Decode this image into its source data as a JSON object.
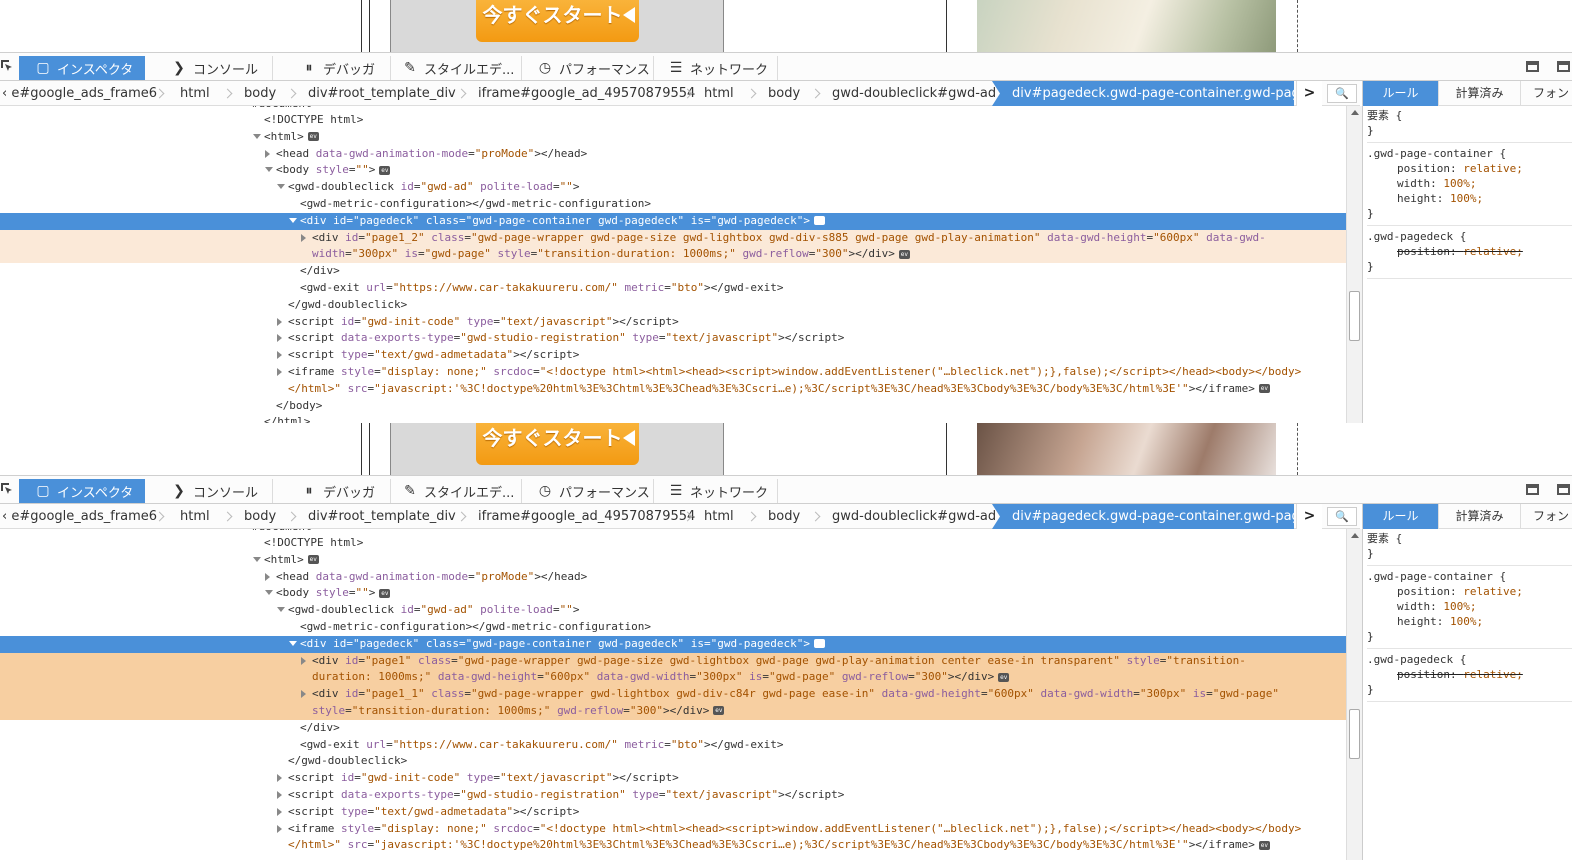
{
  "preview": {
    "ad_button_label": "今すぐスタート"
  },
  "toolbar": {
    "tabs": [
      {
        "label": "インスペクタ",
        "icon": "inspector-icon"
      },
      {
        "label": "コンソール",
        "icon": "console-icon"
      },
      {
        "label": "デバッガ",
        "icon": "debugger-icon"
      },
      {
        "label": "スタイルエデ...",
        "icon": "style-editor-icon"
      },
      {
        "label": "パフォーマンス",
        "icon": "performance-icon"
      },
      {
        "label": "ネットワーク",
        "icon": "network-icon"
      }
    ]
  },
  "breadcrumb": {
    "items": [
      "e#google_ads_frame6",
      "html",
      "body",
      "div#root_template_div",
      "iframe#google_ad_49570879554",
      "html",
      "body",
      "gwd-doubleclick#gwd-ad",
      "div#pagedeck.gwd-page-container.gwd-page..."
    ],
    "overflow_arrow": ">"
  },
  "rules_tabs": [
    "ルール",
    "計算済み",
    "フォン"
  ],
  "rules": [
    {
      "selector": "要素 {",
      "decls": [],
      "close": "}"
    },
    {
      "selector": ".gwd-page-container {",
      "decls": [
        {
          "prop": "position",
          "value": "relative;"
        },
        {
          "prop": "width",
          "value": "100%;"
        },
        {
          "prop": "height",
          "value": "100%;"
        }
      ],
      "close": "}"
    },
    {
      "selector": ".gwd-pagedeck {",
      "decls": [
        {
          "prop": "position",
          "value": "relative;",
          "strike": true
        }
      ],
      "close": "}"
    }
  ],
  "markup_top": [
    {
      "indent": 0,
      "tw": "none",
      "html": "<span class='c-tag'>#document</span>",
      "partial": true
    },
    {
      "indent": 1,
      "tw": "none",
      "html": "<span class='c-tag'>&lt;!DOCTYPE html&gt;</span>"
    },
    {
      "indent": 1,
      "tw": "open",
      "html": "<span class='c-tag'>&lt;html&gt;</span><span class='ev'>ev</span>"
    },
    {
      "indent": 2,
      "tw": "closed",
      "html": "<span class='c-tag'>&lt;head </span><span class='c-attr'>data-gwd-animation-mode</span>=<span class='c-val'>\"proMode\"</span><span class='c-tag'>&gt;&lt;/head&gt;</span>"
    },
    {
      "indent": 2,
      "tw": "open",
      "html": "<span class='c-tag'>&lt;body </span><span class='c-attr'>style</span>=<span class='c-val'>\"\"</span><span class='c-tag'>&gt;</span><span class='ev'>ev</span>"
    },
    {
      "indent": 3,
      "tw": "open",
      "html": "<span class='c-tag'>&lt;gwd-doubleclick </span><span class='c-attr'>id</span>=<span class='c-val'>\"gwd-ad\"</span> <span class='c-attr'>polite-load</span>=<span class='c-val'>\"\"</span><span class='c-tag'>&gt;</span>"
    },
    {
      "indent": 4,
      "tw": "none",
      "html": "<span class='c-tag'>&lt;gwd-metric-configuration&gt;&lt;/gwd-metric-configuration&gt;</span>"
    },
    {
      "indent": 4,
      "tw": "open",
      "cls": "sel",
      "html": "<span class='c-tag'>&lt;div </span><span class='c-attr'>id</span>=<span class='c-val'>\"pagedeck\"</span> <span class='c-attr'>class</span>=<span class='c-val'>\"gwd-page-container gwd-pagedeck\"</span> <span class='c-attr'>is</span>=<span class='c-val'>\"gwd-pagedeck\"</span><span class='c-tag'>&gt;</span><span class='ev'>ev</span>"
    },
    {
      "indent": 5,
      "tw": "closed",
      "cls": "hov",
      "html": "<span class='c-tag'>&lt;div </span><span class='c-attr'>id</span>=<span class='c-val'>\"page1_2\"</span> <span class='c-attr'>class</span>=<span class='c-val'>\"gwd-page-wrapper gwd-page-size gwd-lightbox gwd-div-s885 gwd-page gwd-play-animation\"</span> <span class='c-attr'>data-gwd-height</span>=<span class='c-val'>\"600px\"</span> <span class='c-attr'>data-gwd-</span>"
    },
    {
      "indent": 5,
      "tw": "none",
      "cls": "hov",
      "html": "<span class='c-attr'>width</span>=<span class='c-val'>\"300px\"</span> <span class='c-attr'>is</span>=<span class='c-val'>\"gwd-page\"</span> <span class='c-attr'>style</span>=<span class='c-val'>\"transition-duration: 1000ms;\"</span> <span class='c-attr'>gwd-reflow</span>=<span class='c-val'>\"300\"</span><span class='c-tag'>&gt;&lt;/div&gt;</span><span class='ev'>ev</span>"
    },
    {
      "indent": 4,
      "tw": "none",
      "html": "<span class='c-tag'>&lt;/div&gt;</span>"
    },
    {
      "indent": 4,
      "tw": "none",
      "html": "<span class='c-tag'>&lt;gwd-exit </span><span class='c-attr'>url</span>=<span class='c-val'>\"https://www.car-takakuureru.com/\"</span> <span class='c-attr'>metric</span>=<span class='c-val'>\"bto\"</span><span class='c-tag'>&gt;&lt;/gwd-exit&gt;</span>"
    },
    {
      "indent": 3,
      "tw": "none",
      "html": "<span class='c-tag'>&lt;/gwd-doubleclick&gt;</span>"
    },
    {
      "indent": 3,
      "tw": "closed",
      "html": "<span class='c-tag'>&lt;script </span><span class='c-attr'>id</span>=<span class='c-val'>\"gwd-init-code\"</span> <span class='c-attr'>type</span>=<span class='c-val'>\"text/javascript\"</span><span class='c-tag'>&gt;&lt;/script&gt;</span>"
    },
    {
      "indent": 3,
      "tw": "closed",
      "html": "<span class='c-tag'>&lt;script </span><span class='c-attr'>data-exports-type</span>=<span class='c-val'>\"gwd-studio-registration\"</span> <span class='c-attr'>type</span>=<span class='c-val'>\"text/javascript\"</span><span class='c-tag'>&gt;&lt;/script&gt;</span>"
    },
    {
      "indent": 3,
      "tw": "closed",
      "html": "<span class='c-tag'>&lt;script </span><span class='c-attr'>type</span>=<span class='c-val'>\"text/gwd-admetadata\"</span><span class='c-tag'>&gt;&lt;/script&gt;</span>"
    },
    {
      "indent": 3,
      "tw": "closed",
      "html": "<span class='c-tag'>&lt;iframe </span><span class='c-attr'>style</span>=<span class='c-val'>\"display: none;\"</span> <span class='c-attr'>srcdoc</span>=<span class='c-val'>\"&lt;!doctype html&gt;&lt;html&gt;&lt;head&gt;&lt;script&gt;window.addEventListener(\"…bleclick.net\");},false);&lt;/script&gt;&lt;/head&gt;&lt;body&gt;&lt;/body&gt;</span>"
    },
    {
      "indent": 3,
      "tw": "none",
      "html": "<span class='c-val'>&lt;/html&gt;\"</span> <span class='c-attr'>src</span>=<span class='c-val'>\"javascript:'%3C!doctype%20html%3E%3Chtml%3E%3Chead%3E%3Cscri…e);%3C/script%3E%3C/head%3E%3Cbody%3E%3C/body%3E%3C/html%3E'\"</span><span class='c-tag'>&gt;&lt;/iframe&gt;</span><span class='ev'>ev</span>"
    },
    {
      "indent": 2,
      "tw": "none",
      "html": "<span class='c-tag'>&lt;/body&gt;</span>"
    },
    {
      "indent": 1,
      "tw": "none",
      "html": "<span class='c-tag'>&lt;/html&gt;</span>"
    }
  ],
  "markup_bottom": [
    {
      "indent": 0,
      "tw": "none",
      "html": "<span class='c-tag'>#document</span>",
      "partial": true
    },
    {
      "indent": 1,
      "tw": "none",
      "html": "<span class='c-tag'>&lt;!DOCTYPE html&gt;</span>"
    },
    {
      "indent": 1,
      "tw": "open",
      "html": "<span class='c-tag'>&lt;html&gt;</span><span class='ev'>ev</span>"
    },
    {
      "indent": 2,
      "tw": "closed",
      "html": "<span class='c-tag'>&lt;head </span><span class='c-attr'>data-gwd-animation-mode</span>=<span class='c-val'>\"proMode\"</span><span class='c-tag'>&gt;&lt;/head&gt;</span>"
    },
    {
      "indent": 2,
      "tw": "open",
      "html": "<span class='c-tag'>&lt;body </span><span class='c-attr'>style</span>=<span class='c-val'>\"\"</span><span class='c-tag'>&gt;</span><span class='ev'>ev</span>"
    },
    {
      "indent": 3,
      "tw": "open",
      "html": "<span class='c-tag'>&lt;gwd-doubleclick </span><span class='c-attr'>id</span>=<span class='c-val'>\"gwd-ad\"</span> <span class='c-attr'>polite-load</span>=<span class='c-val'>\"\"</span><span class='c-tag'>&gt;</span>"
    },
    {
      "indent": 4,
      "tw": "none",
      "html": "<span class='c-tag'>&lt;gwd-metric-configuration&gt;&lt;/gwd-metric-configuration&gt;</span>"
    },
    {
      "indent": 4,
      "tw": "open",
      "cls": "sel",
      "html": "<span class='c-tag'>&lt;div </span><span class='c-attr'>id</span>=<span class='c-val'>\"pagedeck\"</span> <span class='c-attr'>class</span>=<span class='c-val'>\"gwd-page-container gwd-pagedeck\"</span> <span class='c-attr'>is</span>=<span class='c-val'>\"gwd-pagedeck\"</span><span class='c-tag'>&gt;</span><span class='ev'>ev</span>"
    },
    {
      "indent": 5,
      "tw": "closed",
      "cls": "hov2",
      "html": "<span class='c-tag'>&lt;div </span><span class='c-attr'>id</span>=<span class='c-val'>\"page1\"</span> <span class='c-attr'>class</span>=<span class='c-val'>\"gwd-page-wrapper gwd-page-size gwd-lightbox gwd-page gwd-play-animation center ease-in transparent\"</span> <span class='c-attr'>style</span>=<span class='c-val'>\"transition-</span>"
    },
    {
      "indent": 5,
      "tw": "none",
      "cls": "hov2",
      "html": "<span class='c-val'>duration: 1000ms;\"</span> <span class='c-attr'>data-gwd-height</span>=<span class='c-val'>\"600px\"</span> <span class='c-attr'>data-gwd-width</span>=<span class='c-val'>\"300px\"</span> <span class='c-attr'>is</span>=<span class='c-val'>\"gwd-page\"</span> <span class='c-attr'>gwd-reflow</span>=<span class='c-val'>\"300\"</span><span class='c-tag'>&gt;&lt;/div&gt;</span><span class='ev'>ev</span>"
    },
    {
      "indent": 5,
      "tw": "closed",
      "cls": "hov2",
      "html": "<span class='c-tag'>&lt;div </span><span class='c-attr'>id</span>=<span class='c-val'>\"page1_1\"</span> <span class='c-attr'>class</span>=<span class='c-val'>\"gwd-page-wrapper gwd-lightbox gwd-div-c84r gwd-page ease-in\"</span> <span class='c-attr'>data-gwd-height</span>=<span class='c-val'>\"600px\"</span> <span class='c-attr'>data-gwd-width</span>=<span class='c-val'>\"300px\"</span> <span class='c-attr'>is</span>=<span class='c-val'>\"gwd-page\"</span>"
    },
    {
      "indent": 5,
      "tw": "none",
      "cls": "hov2",
      "html": "<span class='c-attr'>style</span>=<span class='c-val'>\"transition-duration: 1000ms;\"</span> <span class='c-attr'>gwd-reflow</span>=<span class='c-val'>\"300\"</span><span class='c-tag'>&gt;&lt;/div&gt;</span><span class='ev'>ev</span>"
    },
    {
      "indent": 4,
      "tw": "none",
      "html": "<span class='c-tag'>&lt;/div&gt;</span>"
    },
    {
      "indent": 4,
      "tw": "none",
      "html": "<span class='c-tag'>&lt;gwd-exit </span><span class='c-attr'>url</span>=<span class='c-val'>\"https://www.car-takakuureru.com/\"</span> <span class='c-attr'>metric</span>=<span class='c-val'>\"bto\"</span><span class='c-tag'>&gt;&lt;/gwd-exit&gt;</span>"
    },
    {
      "indent": 3,
      "tw": "none",
      "html": "<span class='c-tag'>&lt;/gwd-doubleclick&gt;</span>"
    },
    {
      "indent": 3,
      "tw": "closed",
      "html": "<span class='c-tag'>&lt;script </span><span class='c-attr'>id</span>=<span class='c-val'>\"gwd-init-code\"</span> <span class='c-attr'>type</span>=<span class='c-val'>\"text/javascript\"</span><span class='c-tag'>&gt;&lt;/script&gt;</span>"
    },
    {
      "indent": 3,
      "tw": "closed",
      "html": "<span class='c-tag'>&lt;script </span><span class='c-attr'>data-exports-type</span>=<span class='c-val'>\"gwd-studio-registration\"</span> <span class='c-attr'>type</span>=<span class='c-val'>\"text/javascript\"</span><span class='c-tag'>&gt;&lt;/script&gt;</span>"
    },
    {
      "indent": 3,
      "tw": "closed",
      "html": "<span class='c-tag'>&lt;script </span><span class='c-attr'>type</span>=<span class='c-val'>\"text/gwd-admetadata\"</span><span class='c-tag'>&gt;&lt;/script&gt;</span>"
    },
    {
      "indent": 3,
      "tw": "closed",
      "html": "<span class='c-tag'>&lt;iframe </span><span class='c-attr'>style</span>=<span class='c-val'>\"display: none;\"</span> <span class='c-attr'>srcdoc</span>=<span class='c-val'>\"&lt;!doctype html&gt;&lt;html&gt;&lt;head&gt;&lt;script&gt;window.addEventListener(\"…bleclick.net\");},false);&lt;/script&gt;&lt;/head&gt;&lt;body&gt;&lt;/body&gt;</span>"
    },
    {
      "indent": 3,
      "tw": "none",
      "html": "<span class='c-val'>&lt;/html&gt;\"</span> <span class='c-attr'>src</span>=<span class='c-val'>\"javascript:'%3C!doctype%20html%3E%3Chtml%3E%3Chead%3E%3Cscri…e);%3C/script%3E%3C/head%3E%3Cbody%3E%3C/body%3E%3C/html%3E'\"</span><span class='c-tag'>&gt;&lt;/iframe&gt;</span><span class='ev'>ev</span>"
    }
  ]
}
